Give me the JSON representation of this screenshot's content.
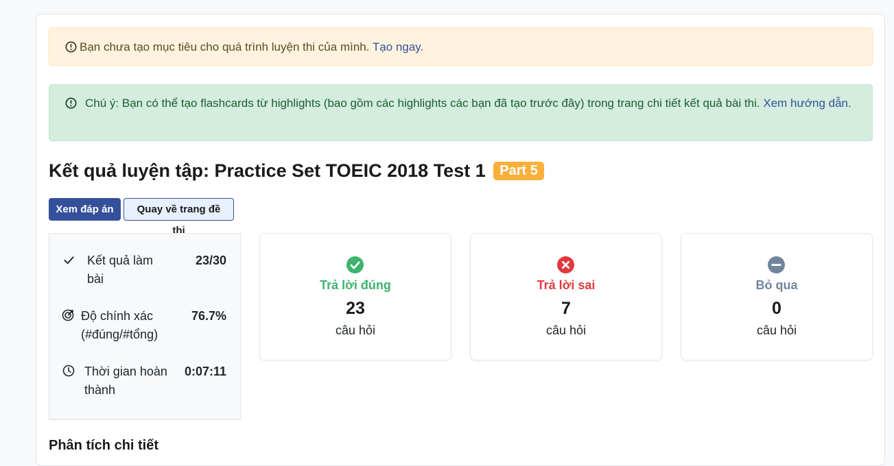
{
  "alerts": {
    "goal_text": "Bạn chưa tạo mục tiêu cho quá trình luyện thi của mình.",
    "goal_link": "Tạo ngay",
    "goal_suffix": ".",
    "note_text": "Chú ý: Bạn có thể tạo flashcards từ highlights (bao gồm các highlights các bạn đã tạo trước đây) trong trang chi tiết kết quả bài thi.",
    "note_link": "Xem hướng dẫn",
    "note_suffix": "."
  },
  "result": {
    "title": "Kết quả luyện tập: Practice Set TOEIC 2018 Test 1",
    "badge": "Part 5"
  },
  "buttons": {
    "view_answers": "Xem đáp án",
    "back_to_test": "Quay về trang đề thi"
  },
  "stats": {
    "score_label": "Kết quả làm bài",
    "score_value": "23/30",
    "accuracy_label": "Độ chính xác (#đúng/#tổng)",
    "accuracy_value": "76.7%",
    "time_label": "Thời gian hoàn thành",
    "time_value": "0:07:11"
  },
  "cards": {
    "correct": {
      "label": "Trả lời đúng",
      "count": "23",
      "unit": "câu hỏi",
      "color": "#3cb46e"
    },
    "wrong": {
      "label": "Trả lời sai",
      "count": "7",
      "unit": "câu hỏi",
      "color": "#e03a3e"
    },
    "skipped": {
      "label": "Bỏ qua",
      "count": "0",
      "unit": "câu hỏi",
      "color": "#71869d"
    }
  },
  "section": {
    "detail_title": "Phân tích chi tiết"
  },
  "colors": {
    "primary": "#35509a",
    "badge": "#fbb03b",
    "warning_bg": "#fff3e0",
    "success_bg": "#d4edde"
  }
}
